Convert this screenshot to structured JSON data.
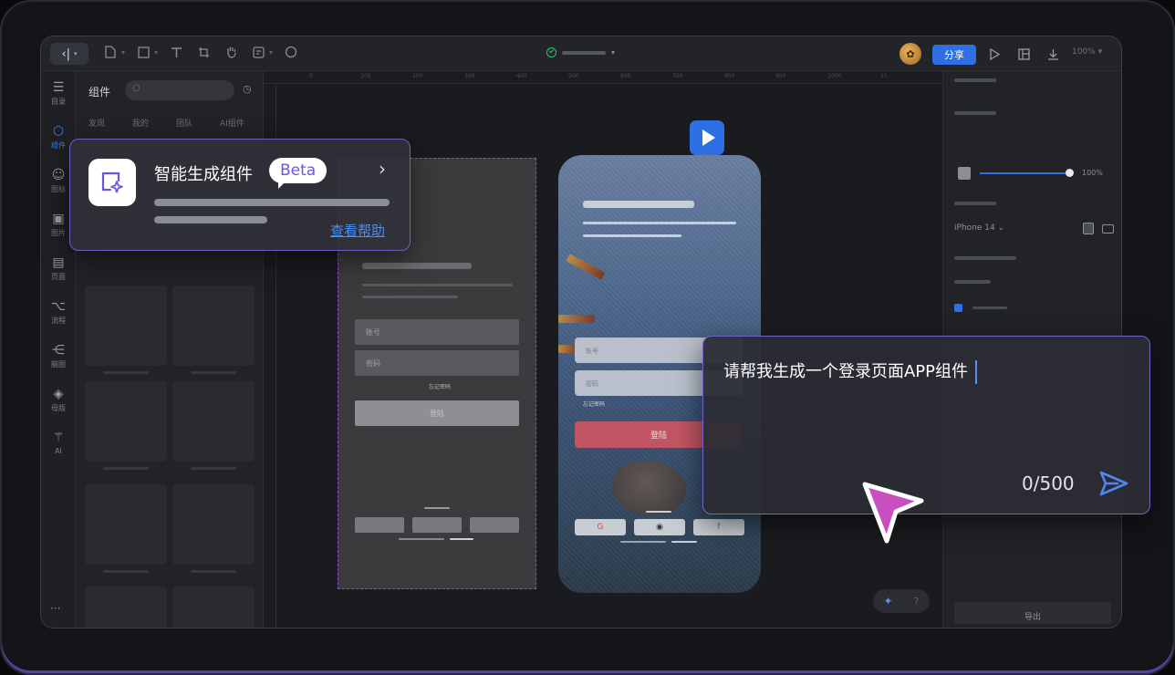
{
  "toolbar": {
    "back_label": "‹|",
    "share_label": "分享",
    "zoom_label": "100%"
  },
  "rail": {
    "items": [
      {
        "label": "目录",
        "icon": "list-icon"
      },
      {
        "label": "组件",
        "icon": "component-icon"
      },
      {
        "label": "图标",
        "icon": "smiley-icon"
      },
      {
        "label": "图片",
        "icon": "image-icon"
      },
      {
        "label": "页面",
        "icon": "page-icon"
      },
      {
        "label": "流程",
        "icon": "flow-icon"
      },
      {
        "label": "脑图",
        "icon": "mindmap-icon"
      },
      {
        "label": "母版",
        "icon": "master-icon"
      },
      {
        "label": "AI",
        "icon": "magic-wand-icon"
      }
    ],
    "more": "···"
  },
  "panel": {
    "title": "组件",
    "tabs": [
      "发现",
      "我的",
      "团队",
      "AI组件"
    ]
  },
  "ruler": {
    "ticks": [
      "0",
      "100",
      "200",
      "300",
      "400",
      "500",
      "600",
      "700",
      "800",
      "900",
      "1000",
      "11"
    ]
  },
  "wireframe": {
    "account_placeholder": "账号",
    "password_placeholder": "密码",
    "forgot": "忘记密码",
    "button": "登陆"
  },
  "phone": {
    "account_placeholder": "账号",
    "password_placeholder": "密码",
    "forgot": "忘记密码",
    "login_button": "登陆",
    "social": [
      "G",
      "◉",
      "f"
    ]
  },
  "properties": {
    "opacity": "100%",
    "device": "iPhone 14 ⌄",
    "export_label": "导出"
  },
  "smart_card": {
    "title": "智能生成组件",
    "badge": "Beta",
    "help_link": "查看帮助"
  },
  "prompt_card": {
    "text": "请帮我生成一个登录页面APP组件",
    "counter": "0/500"
  },
  "colors": {
    "accent_blue": "#2f6fe4",
    "accent_purple": "#6b5fc4",
    "cursor_pink": "#c94fc0"
  }
}
